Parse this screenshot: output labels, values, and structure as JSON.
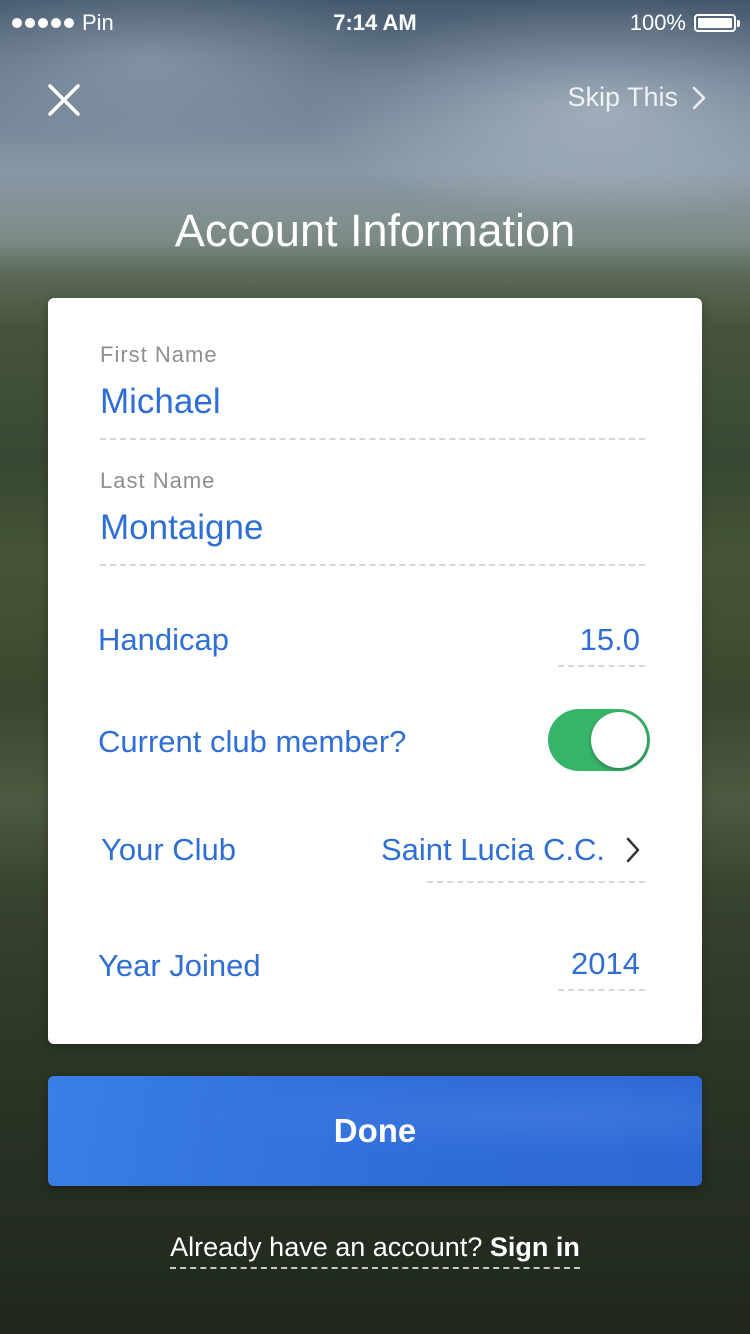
{
  "status_bar": {
    "carrier": "Pin",
    "time": "7:14 AM",
    "battery": "100%"
  },
  "nav": {
    "close_icon": "close-icon",
    "skip_label": "Skip This",
    "skip_icon": "chevron-right-icon"
  },
  "page_title": "Account Information",
  "form": {
    "first_name": {
      "label": "First Name",
      "value": "Michael"
    },
    "last_name": {
      "label": "Last Name",
      "value": "Montaigne"
    },
    "handicap": {
      "label": "Handicap",
      "value": "15.0"
    },
    "club_member": {
      "label": "Current club member?",
      "on": true
    },
    "club": {
      "label": "Your Club",
      "value": "Saint Lucia C.C."
    },
    "year_joined": {
      "label": "Year Joined",
      "value": "2014"
    }
  },
  "done_label": "Done",
  "signin": {
    "prompt": "Already have an account?",
    "link": "Sign in"
  },
  "colors": {
    "accent": "#2f6fd5",
    "toggle_on": "#36b469",
    "button": "#2f6ddb"
  }
}
